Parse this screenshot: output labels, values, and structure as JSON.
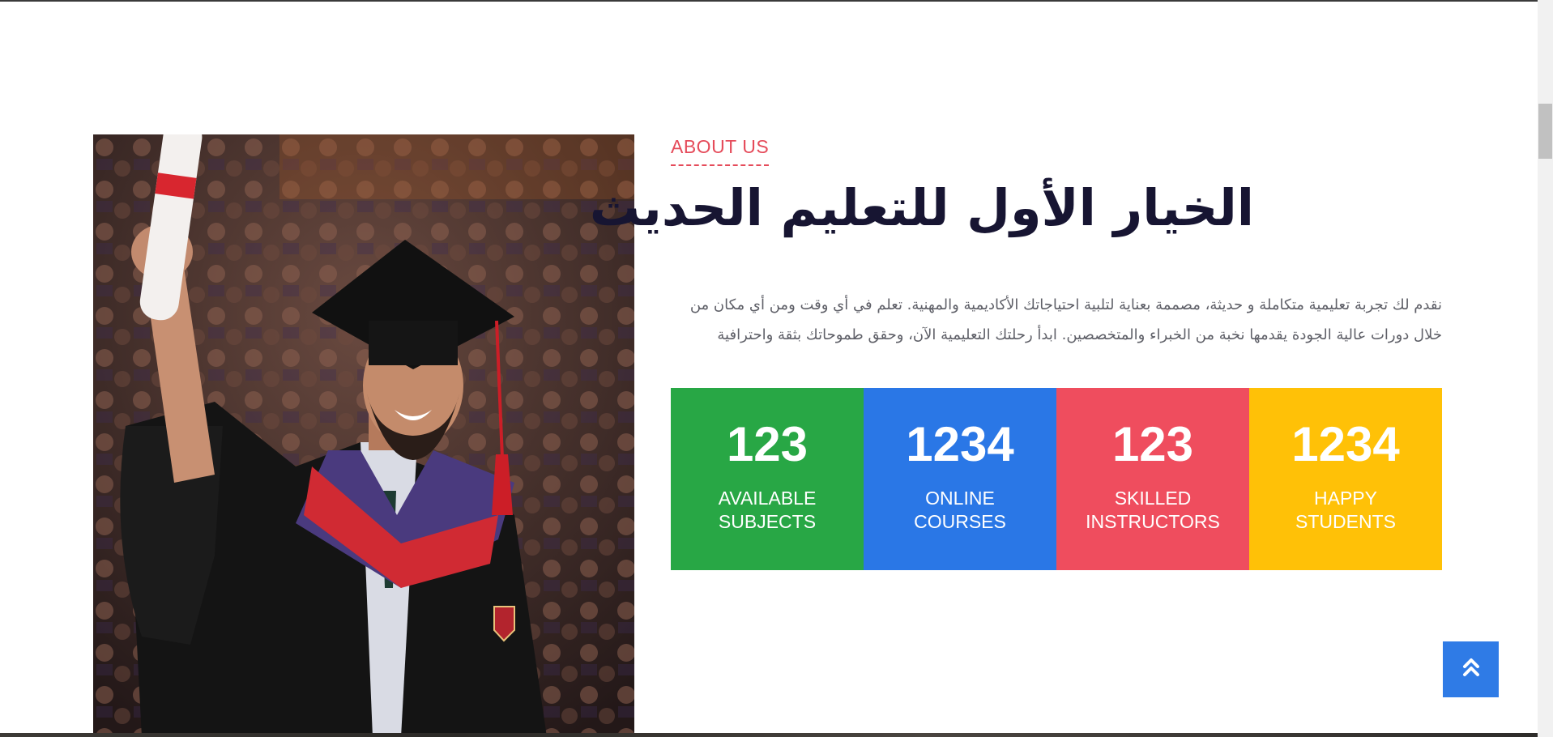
{
  "about": {
    "eyebrow": "ABOUT US",
    "title": "الخيار الأول للتعليم الحديث",
    "description": "نقدم لك تجربة تعليمية متكاملة و حديثة، مصممة بعناية لتلبية احتياجاتك الأكاديمية والمهنية. تعلم في أي وقت ومن أي مكان من خلال دورات عالية الجودة يقدمها نخبة من الخبراء والمتخصصين. ابدأ رحلتك التعليمية الآن، وحقق طموحاتك بثقة واحترافية"
  },
  "stats": [
    {
      "value": "123",
      "label": "AVAILABLE SUBJECTS",
      "color": "#28a745"
    },
    {
      "value": "1234",
      "label": "ONLINE COURSES",
      "color": "#2a77e6"
    },
    {
      "value": "123",
      "label": "SKILLED INSTRUCTORS",
      "color": "#ef4d5e"
    },
    {
      "value": "1234",
      "label": "HAPPY STUDENTS",
      "color": "#ffc107"
    }
  ],
  "icons": {
    "back_to_top": "double-chevron-up-icon"
  },
  "colors": {
    "accent": "#e54b5a",
    "heading": "#171532",
    "text": "#5f6068",
    "button": "#2f7be6"
  }
}
